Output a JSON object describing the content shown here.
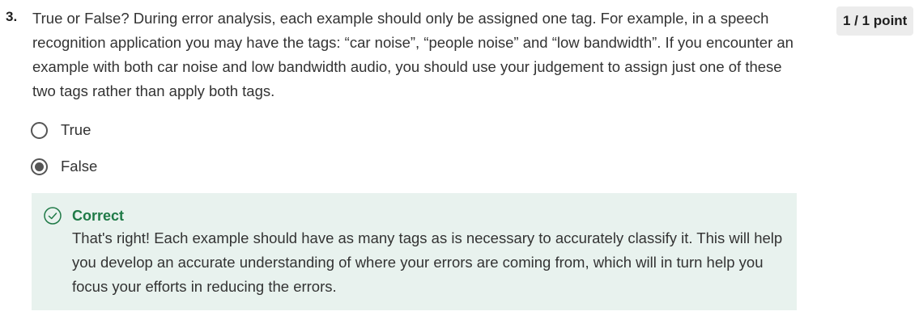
{
  "question": {
    "number": "3.",
    "text": "True or False? During error analysis, each example should only be assigned one tag. For example, in a speech recognition application you may have the tags: “car noise”, “people noise” and “low bandwidth”. If you encounter an example with both car noise and low bandwidth audio, you should use your judgement to assign just one of these two tags rather than apply both tags.",
    "points": "1 / 1 point"
  },
  "options": [
    {
      "label": "True",
      "selected": false
    },
    {
      "label": "False",
      "selected": true
    }
  ],
  "feedback": {
    "status": "Correct",
    "icon": "check-circle-icon",
    "text": "That's right! Each example should have as many tags as is necessary to accurately classify it. This will help you develop an accurate understanding of where your errors are coming from, which will in turn help you focus your efforts in reducing the errors."
  },
  "colors": {
    "feedback_bg": "#e8f2ee",
    "correct_green": "#1f7a47",
    "badge_bg": "#ececec"
  }
}
